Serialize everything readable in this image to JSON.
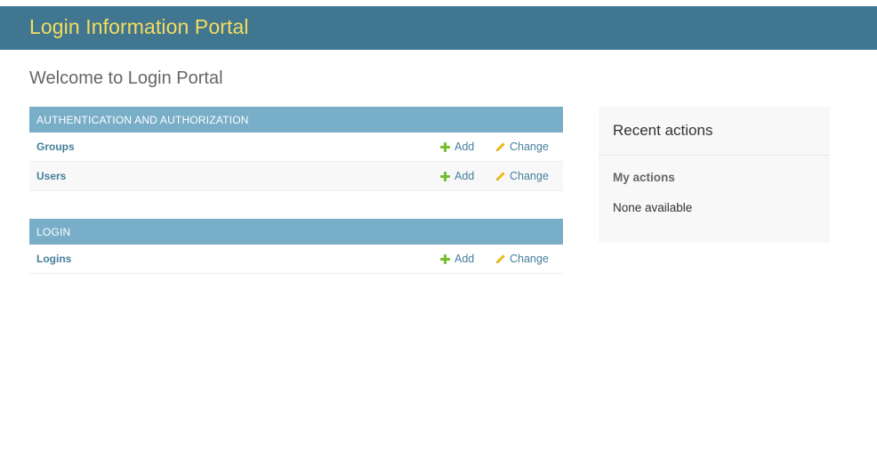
{
  "header": {
    "brand": "Login Information Portal"
  },
  "page": {
    "title": "Welcome to Login Portal"
  },
  "modules": [
    {
      "caption": "AUTHENTICATION AND AUTHORIZATION",
      "rows": [
        {
          "name": "Groups",
          "add": "Add",
          "change": "Change"
        },
        {
          "name": "Users",
          "add": "Add",
          "change": "Change"
        }
      ]
    },
    {
      "caption": "LOGIN",
      "rows": [
        {
          "name": "Logins",
          "add": "Add",
          "change": "Change"
        }
      ]
    }
  ],
  "recent_actions": {
    "title": "Recent actions",
    "subtitle": "My actions",
    "empty_text": "None available"
  },
  "colors": {
    "header_bg": "#417690",
    "brand": "#f5dd5d",
    "caption_bg": "#79aec8",
    "link": "#447e9b",
    "add_icon": "#70bf2b",
    "change_icon": "#efb80b"
  },
  "icons": {
    "add": "plus-icon",
    "change": "pencil-icon"
  }
}
